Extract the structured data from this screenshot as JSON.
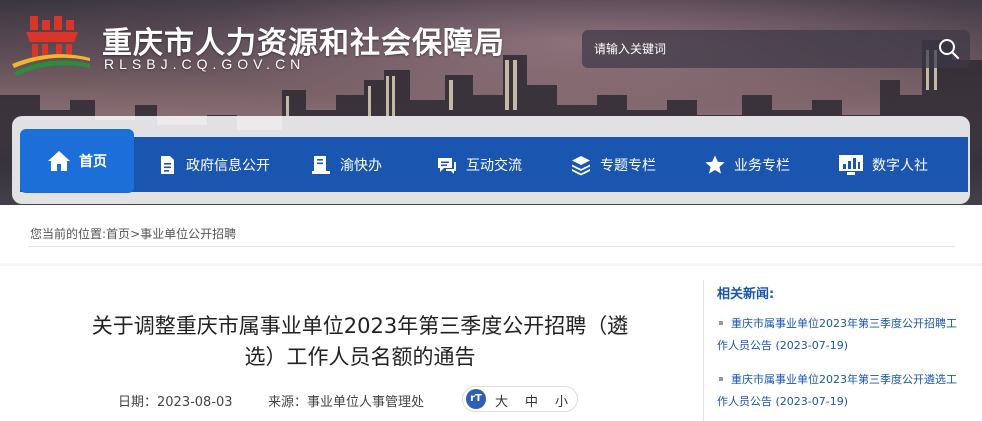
{
  "header": {
    "site_title": "重庆市人力资源和社会保障局",
    "site_domain": "RLSBJ.CQ.GOV.CN",
    "search_placeholder": "请输入关键词",
    "search_icon": "search-icon"
  },
  "nav": {
    "items": [
      {
        "label": "首页",
        "icon": "home-icon"
      },
      {
        "label": "政府信息公开",
        "icon": "document-icon"
      },
      {
        "label": "渝快办",
        "icon": "service-icon"
      },
      {
        "label": "互动交流",
        "icon": "chat-icon"
      },
      {
        "label": "专题专栏",
        "icon": "layers-icon"
      },
      {
        "label": "业务专栏",
        "icon": "star-icon"
      },
      {
        "label": "数字人社",
        "icon": "monitor-chart-icon"
      }
    ]
  },
  "breadcrumb": {
    "prefix": "您当前的位置:",
    "home": "首页",
    "separator": ">",
    "current": "事业单位公开招聘"
  },
  "article": {
    "title_line1": "关于调整重庆市属事业单位2023年第三季度公开招聘（遴",
    "title_line2": "选）工作人员名额的通告",
    "date_label": "日期：",
    "date": "2023-08-03",
    "source_label": "来源：",
    "source": "事业单位人事管理处",
    "font_size_options": [
      "大",
      "中",
      "小"
    ]
  },
  "related": {
    "heading": "相关新闻:",
    "items": [
      {
        "line1": "重庆市属事业单位2023年第三季度公开招聘工",
        "line2": "作人员公告 (2023-07-19)"
      },
      {
        "line1": "重庆市属事业单位2023年第三季度公开遴选工",
        "line2": "作人员公告 (2023-07-19)"
      }
    ]
  },
  "colors": {
    "nav_bg": "#1a56b0",
    "nav_active": "#1c6fd9",
    "link": "#1a56b0"
  }
}
